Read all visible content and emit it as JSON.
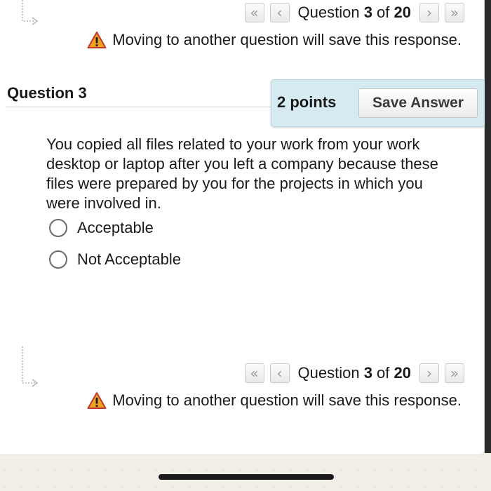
{
  "top_nav": {
    "first_label": "«",
    "prev_label": "‹",
    "question_prefix": "Question ",
    "current": "3",
    "of_text": " of ",
    "total": "20",
    "next_label": "›",
    "last_label": "»"
  },
  "warning": {
    "text": "Moving to another question will save this response."
  },
  "question": {
    "title": "Question 3",
    "points": "2 points",
    "save_label": "Save Answer",
    "text": "You copied all files related to your work from your work desktop or laptop after you left a company because these files were prepared by you for the projects in which you were involved in.",
    "options": [
      {
        "label": "Acceptable",
        "selected": false
      },
      {
        "label": "Not Acceptable",
        "selected": false
      }
    ]
  },
  "bottom_nav": {
    "first_label": "«",
    "prev_label": "‹",
    "question_prefix": "Question ",
    "current": "3",
    "of_text": " of ",
    "total": "20",
    "next_label": "›",
    "last_label": "»"
  },
  "colors": {
    "points_bg": "#d6ebf1",
    "warning_icon": "#f0a020"
  }
}
